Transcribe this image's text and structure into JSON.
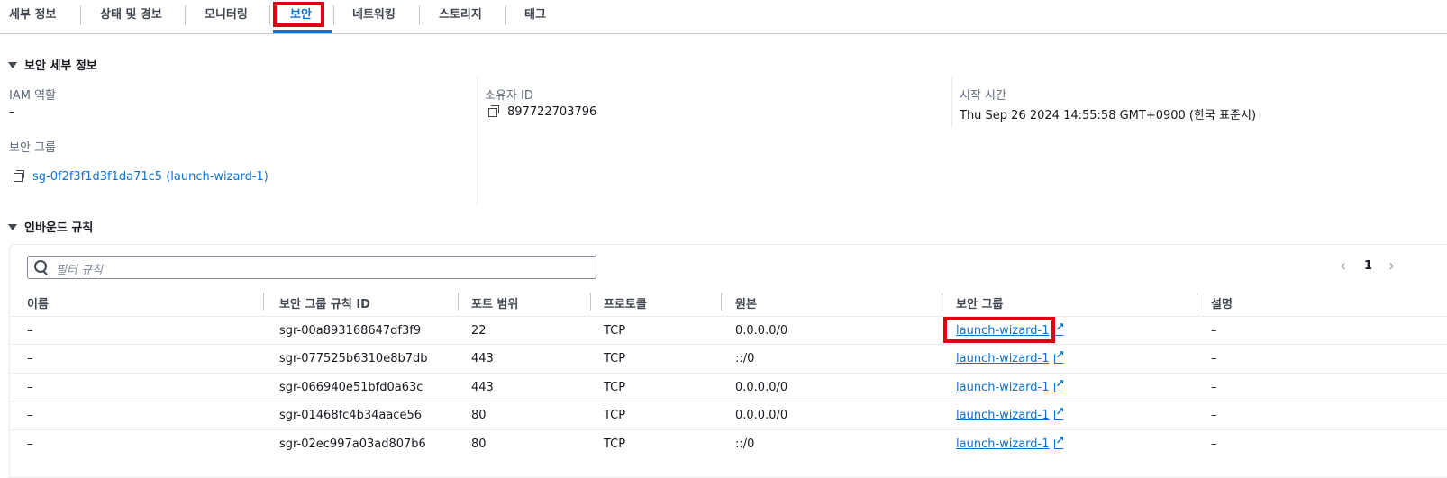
{
  "tabs": [
    {
      "label": "세부 정보"
    },
    {
      "label": "상태 및 경보"
    },
    {
      "label": "모니터링"
    },
    {
      "label": "보안"
    },
    {
      "label": "네트워킹"
    },
    {
      "label": "스토리지"
    },
    {
      "label": "태그"
    }
  ],
  "active_tab": "보안",
  "security_details": {
    "title": "보안 세부 정보",
    "iam_role_label": "IAM 역할",
    "iam_role_value": "–",
    "owner_id_label": "소유자 ID",
    "owner_id_value": "897722703796",
    "launch_time_label": "시작 시간",
    "launch_time_value": "Thu Sep 26 2024 14:55:58 GMT+0900 (한국 표준시)",
    "security_group_label": "보안 그룹",
    "security_group_value": "sg-0f2f3f1d3f1da71c5 (launch-wizard-1)"
  },
  "inbound": {
    "title": "인바운드 규칙",
    "filter_placeholder": "필터 규칙",
    "page": "1",
    "columns": [
      "이름",
      "보안 그룹 규칙 ID",
      "포트 범위",
      "프로토콜",
      "원본",
      "보안 그룹",
      "설명"
    ],
    "rows": [
      {
        "name": "–",
        "rule_id": "sgr-00a893168647df3f9",
        "port": "22",
        "protocol": "TCP",
        "source": "0.0.0.0/0",
        "sg": "launch-wizard-1",
        "desc": "–"
      },
      {
        "name": "–",
        "rule_id": "sgr-077525b6310e8b7db",
        "port": "443",
        "protocol": "TCP",
        "source": "::/0",
        "sg": "launch-wizard-1",
        "desc": "–"
      },
      {
        "name": "–",
        "rule_id": "sgr-066940e51bfd0a63c",
        "port": "443",
        "protocol": "TCP",
        "source": "0.0.0.0/0",
        "sg": "launch-wizard-1",
        "desc": "–"
      },
      {
        "name": "–",
        "rule_id": "sgr-01468fc4b34aace56",
        "port": "80",
        "protocol": "TCP",
        "source": "0.0.0.0/0",
        "sg": "launch-wizard-1",
        "desc": "–"
      },
      {
        "name": "–",
        "rule_id": "sgr-02ec997a03ad807b6",
        "port": "80",
        "protocol": "TCP",
        "source": "::/0",
        "sg": "launch-wizard-1",
        "desc": "–"
      }
    ]
  },
  "colors": {
    "accent": "#0972d3",
    "highlight": "#e00012"
  }
}
